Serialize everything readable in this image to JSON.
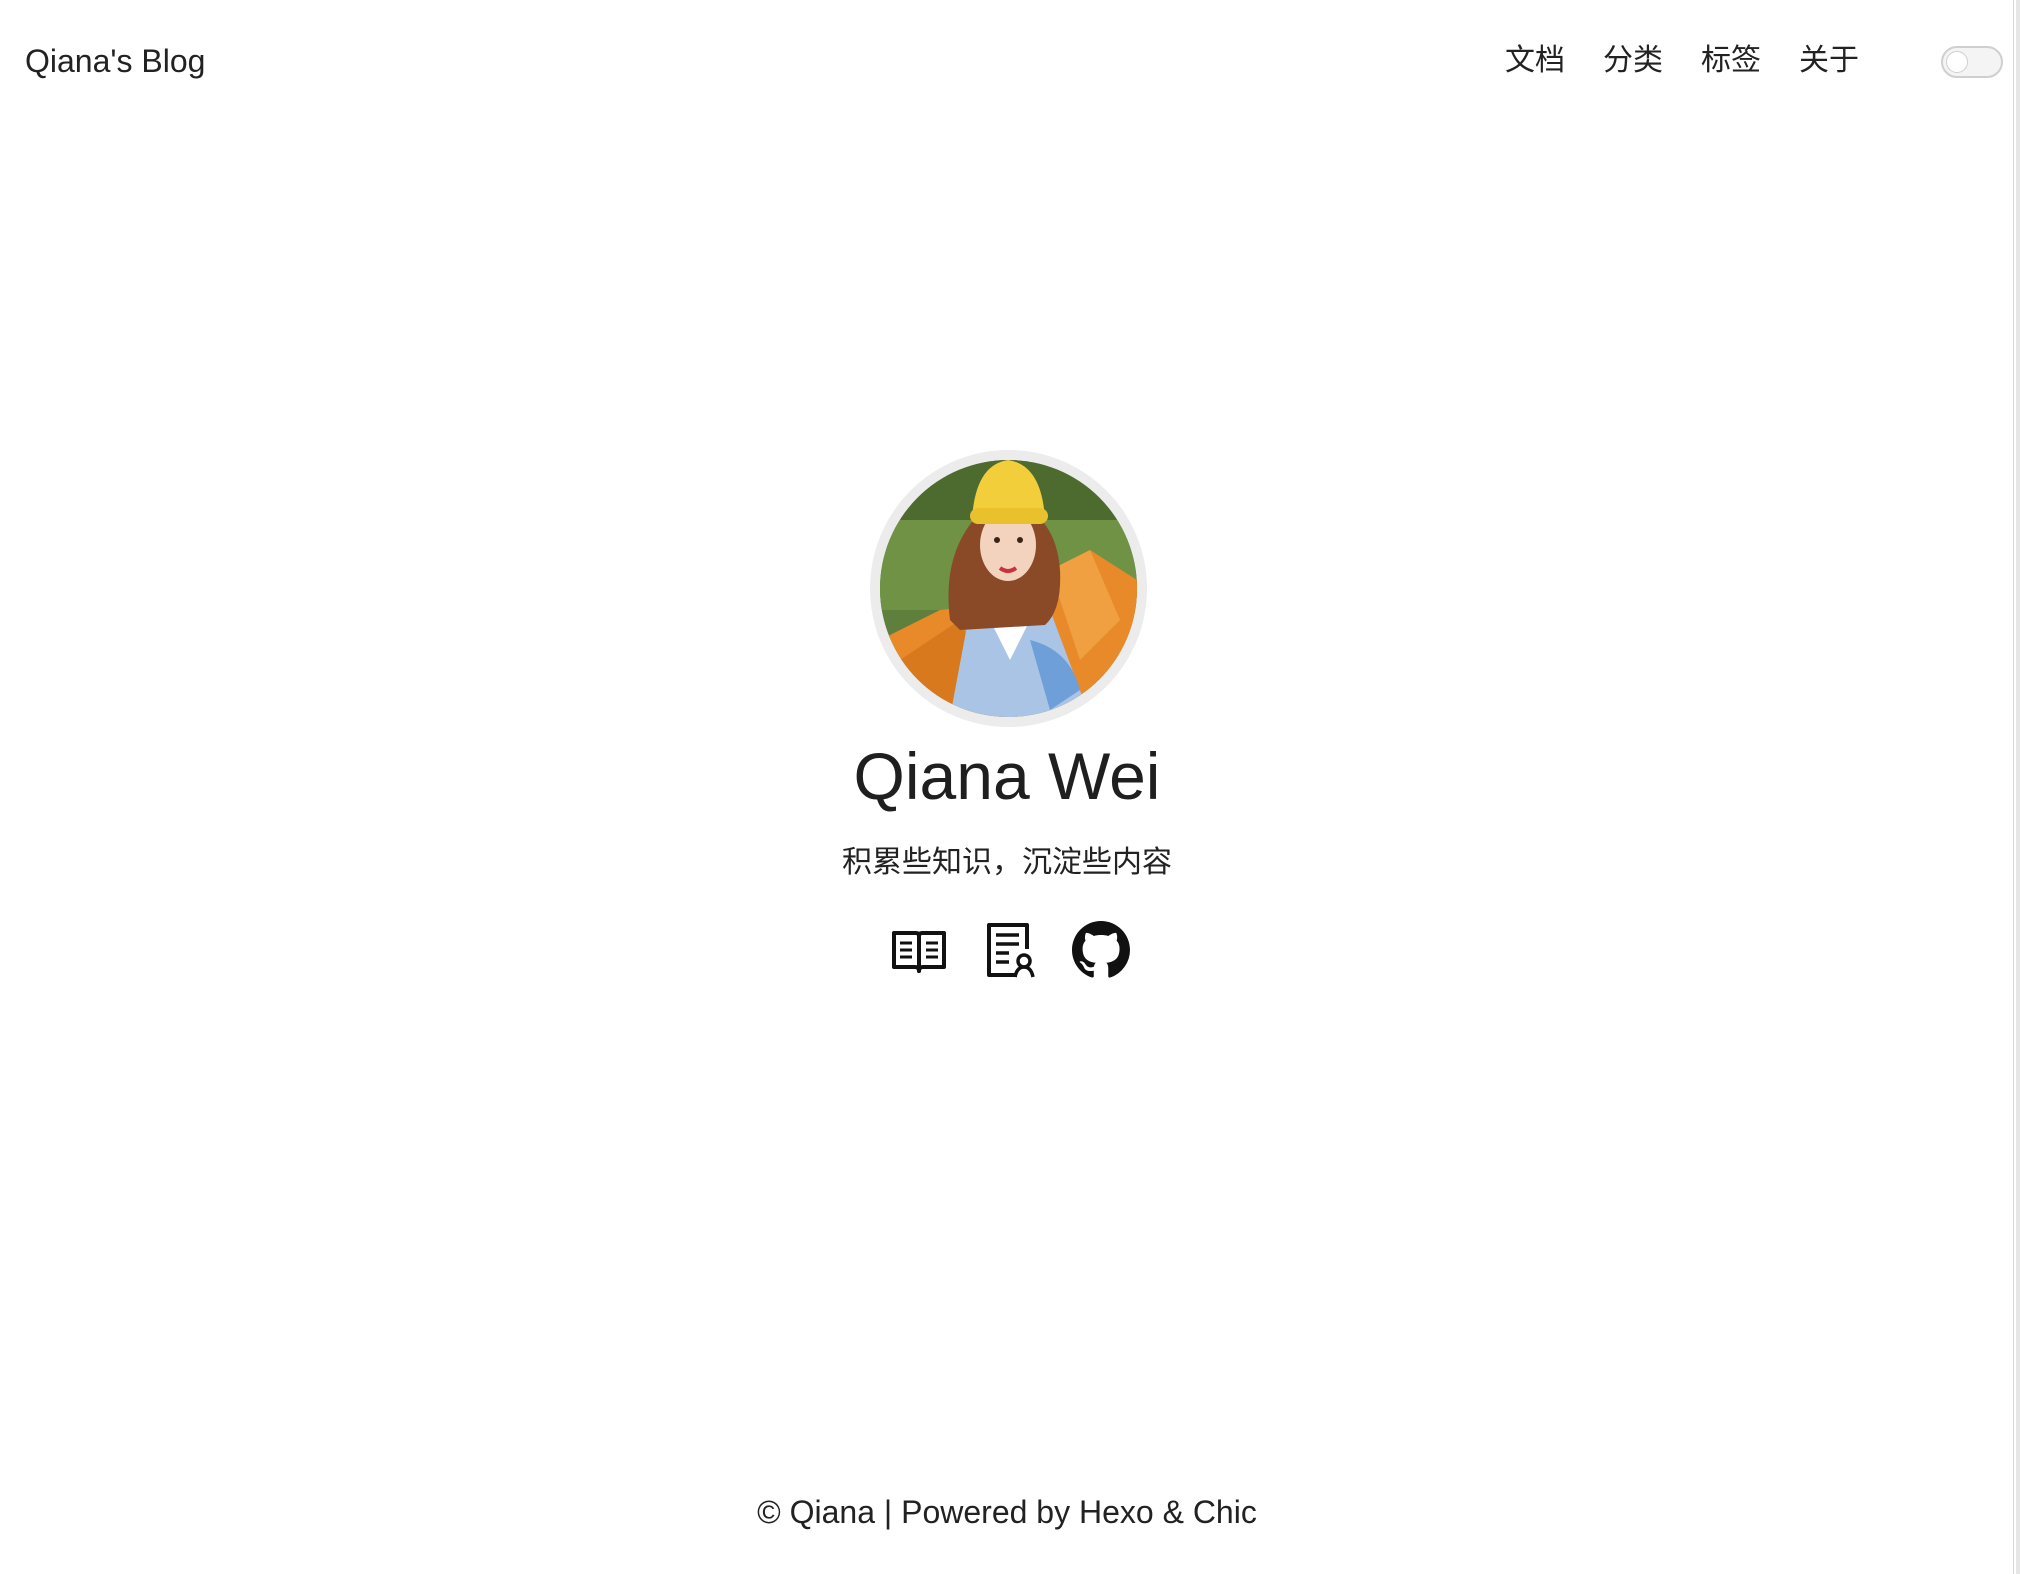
{
  "header": {
    "site_title": "Qiana's Blog",
    "nav": [
      {
        "label": "文档"
      },
      {
        "label": "分类"
      },
      {
        "label": "标签"
      },
      {
        "label": "关于"
      }
    ]
  },
  "profile": {
    "name": "Qiana Wei",
    "motto": "积累些知识，沉淀些内容",
    "social_icons": [
      "book-icon",
      "certificate-icon",
      "github-icon"
    ]
  },
  "footer": {
    "copyright": "© Qiana",
    "separator": "|",
    "powered_by": "Powered by",
    "hexo": "Hexo",
    "amp": "&",
    "chic": "Chic"
  },
  "colors": {
    "text": "#222222",
    "background": "#ffffff"
  }
}
